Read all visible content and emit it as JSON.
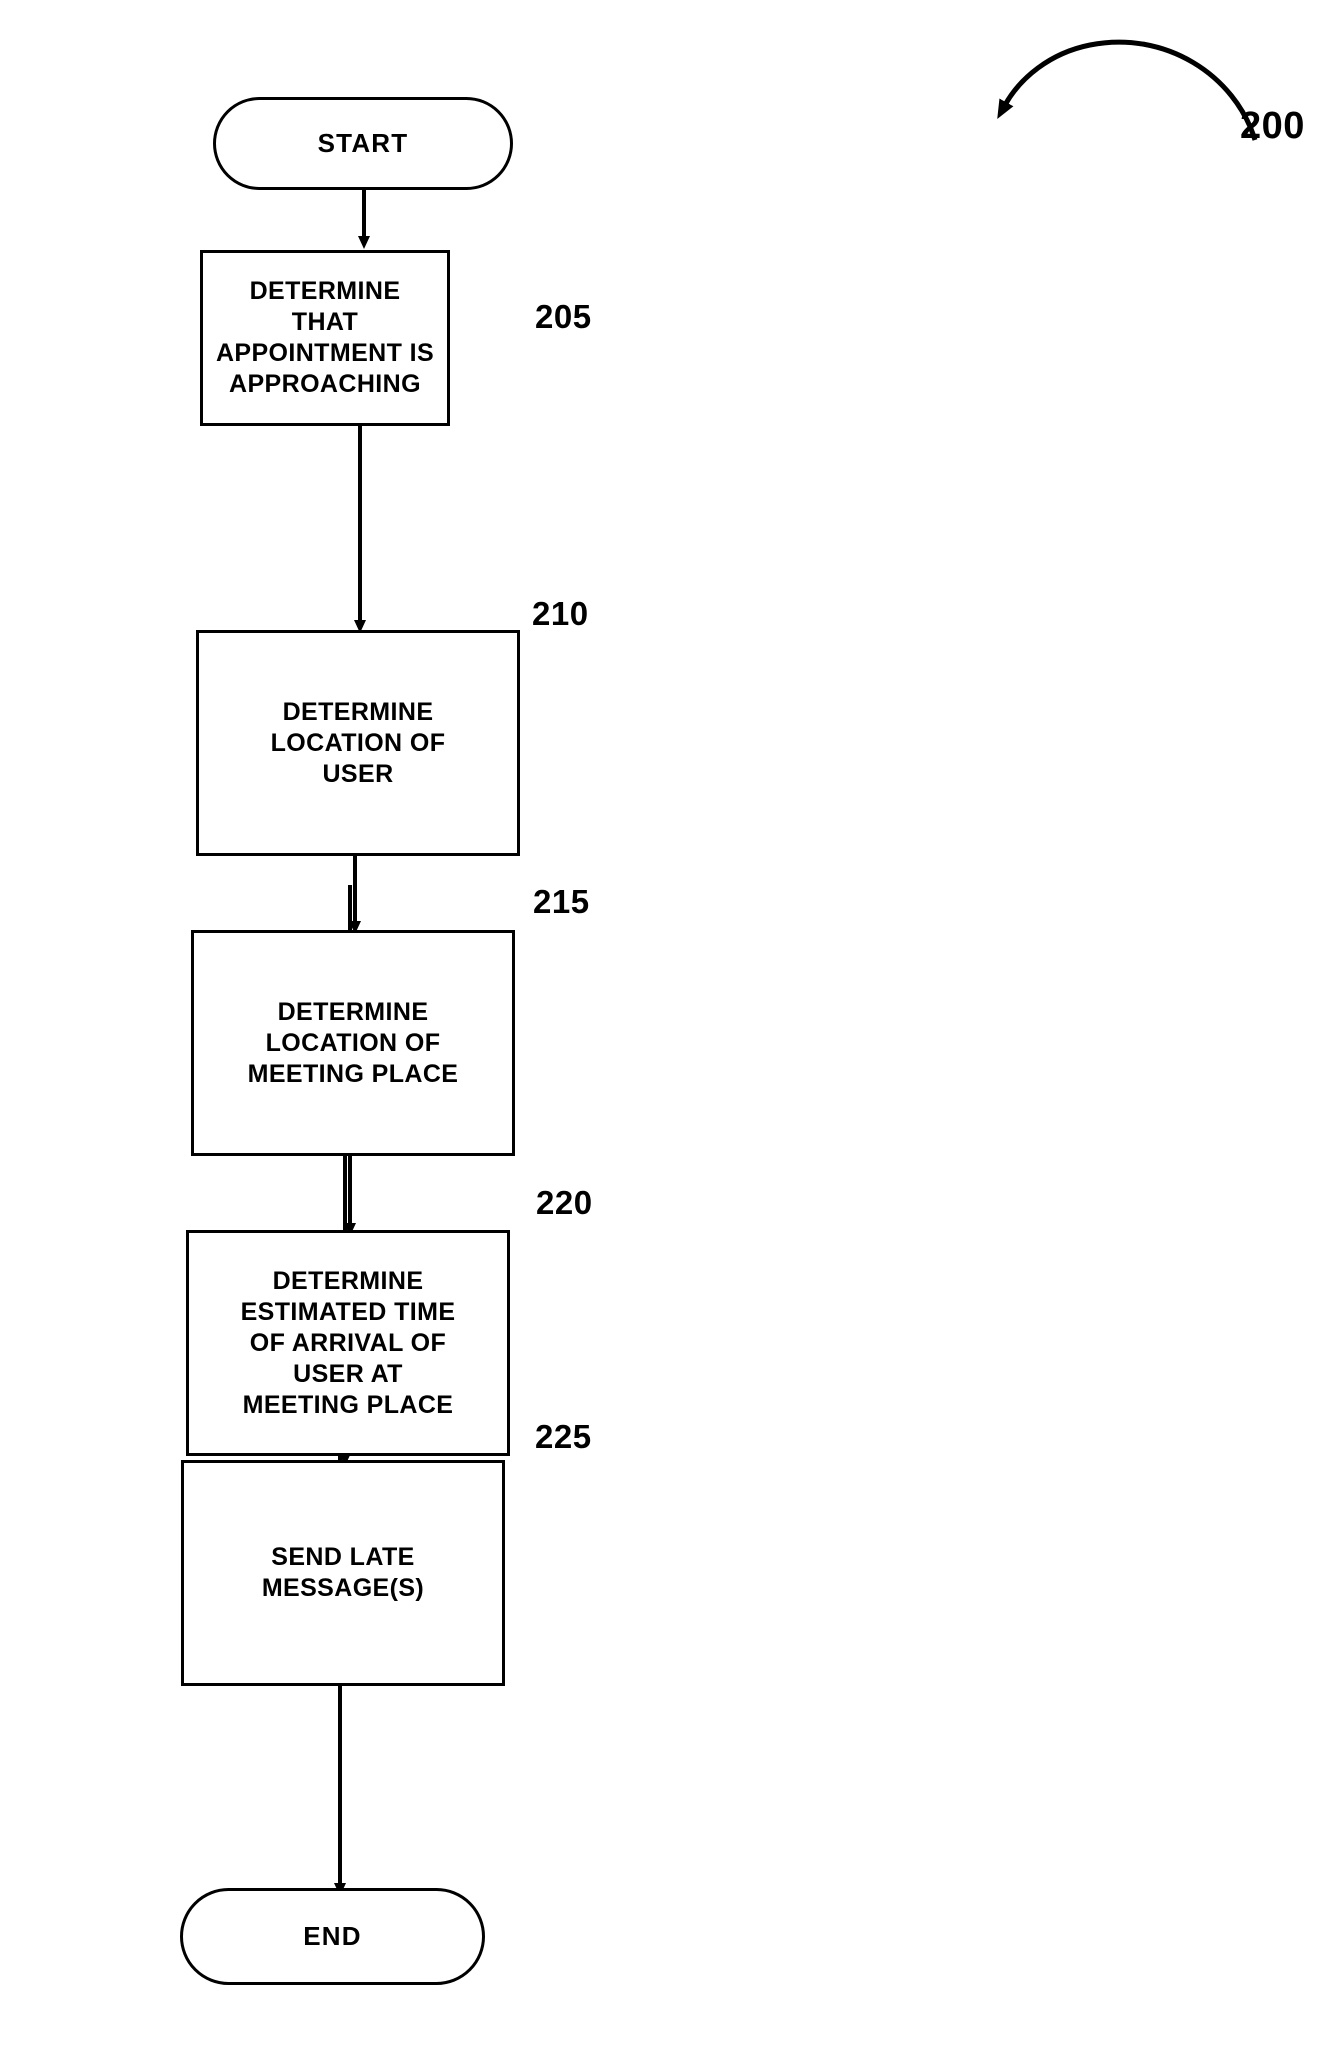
{
  "figure": {
    "reference_label": "200",
    "background_color": "#ffffff",
    "line_color": "#000000"
  },
  "flowchart": {
    "nodes": [
      {
        "id": "start",
        "shape": "terminal",
        "label": "START",
        "ref": null
      },
      {
        "id": "step-205",
        "shape": "process",
        "label": "DETERMINE\nTHAT\nAPPOINTMENT IS\nAPPROACHING",
        "ref": "205"
      },
      {
        "id": "step-210",
        "shape": "process",
        "label": "DETERMINE\nLOCATION OF\nUSER",
        "ref": "210"
      },
      {
        "id": "step-215",
        "shape": "process",
        "label": "DETERMINE\nLOCATION OF\nMEETING PLACE",
        "ref": "215"
      },
      {
        "id": "step-220",
        "shape": "process",
        "label": "DETERMINE\nESTIMATED TIME\nOF ARRIVAL OF\nUSER AT\nMEETING PLACE",
        "ref": "220"
      },
      {
        "id": "step-225",
        "shape": "process",
        "label": "SEND LATE\nMESSAGE(S)",
        "ref": "225"
      },
      {
        "id": "end",
        "shape": "terminal",
        "label": "END",
        "ref": null
      }
    ],
    "connectors": [
      {
        "from": "start",
        "to": "step-205",
        "arrowhead": "solid-triangle"
      },
      {
        "from": "step-205",
        "to": "step-210",
        "arrowhead": "solid-triangle"
      },
      {
        "from": "step-210",
        "to": "step-215",
        "arrowhead": "solid-triangle"
      },
      {
        "from": "step-215",
        "to": "step-220",
        "arrowhead": "solid-triangle"
      },
      {
        "from": "step-220",
        "to": "step-225",
        "arrowhead": "solid-triangle"
      },
      {
        "from": "step-225",
        "to": "end",
        "arrowhead": "solid-triangle"
      }
    ]
  }
}
